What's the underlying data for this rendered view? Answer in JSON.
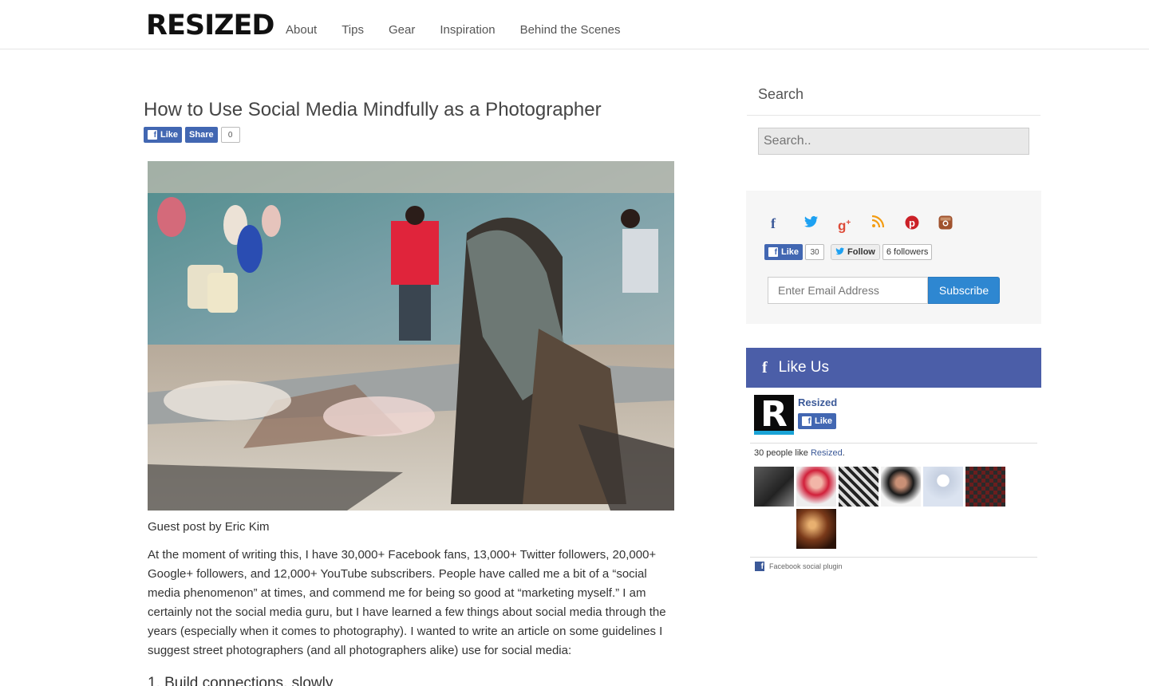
{
  "header": {
    "logo": "RESIZED",
    "nav": [
      "About",
      "Tips",
      "Gear",
      "Inspiration",
      "Behind the Scenes"
    ]
  },
  "article": {
    "title": "How to Use Social Media Mindfully as a Photographer",
    "like_label": "Like",
    "share_label": "Share",
    "share_count": "0",
    "byline": "Guest post by Eric Kim",
    "paragraph": "At the moment of writing this, I have 30,000+ Facebook fans, 13,000+ Twitter followers, 20,000+ Google+ followers, and 12,000+ YouTube subscribers. People have called me a bit of a “social media phenomenon” at times, and commend me for being so good at “marketing myself.” I am certainly not the social media guru, but I have learned a few things about social media through the years (especially when it comes to photography). I wanted to write an article on some guidelines I suggest street photographers (and all photographers alike) use for social media:",
    "subhead": "1. Build connections, slowly"
  },
  "sidebar": {
    "search_title": "Search",
    "search_placeholder": "Search..",
    "social_icons": [
      {
        "name": "facebook-icon",
        "glyph": "f",
        "color": "#3b5998"
      },
      {
        "name": "twitter-icon",
        "glyph": "🐦",
        "color": "#1da1f2"
      },
      {
        "name": "google-plus-icon",
        "glyph": "g+",
        "color": "#dd4b39"
      },
      {
        "name": "rss-icon",
        "glyph": "◠",
        "color": "#f39c12"
      },
      {
        "name": "pinterest-icon",
        "glyph": "P",
        "color": "#cb2027"
      },
      {
        "name": "instagram-icon",
        "glyph": "◙",
        "color": "#a0522d"
      }
    ],
    "fb_like_label": "Like",
    "fb_like_count": "30",
    "twitter_follow_label": "Follow",
    "twitter_followers": "6 followers",
    "email_placeholder": "Enter Email Address",
    "subscribe_label": "Subscribe",
    "like_us_title": "Like Us",
    "page_name": "Resized",
    "page_like_label": "Like",
    "people_like_prefix": "30 people like ",
    "people_like_page": "Resized",
    "people_like_suffix": ".",
    "plugin_label": "Facebook social plugin"
  }
}
